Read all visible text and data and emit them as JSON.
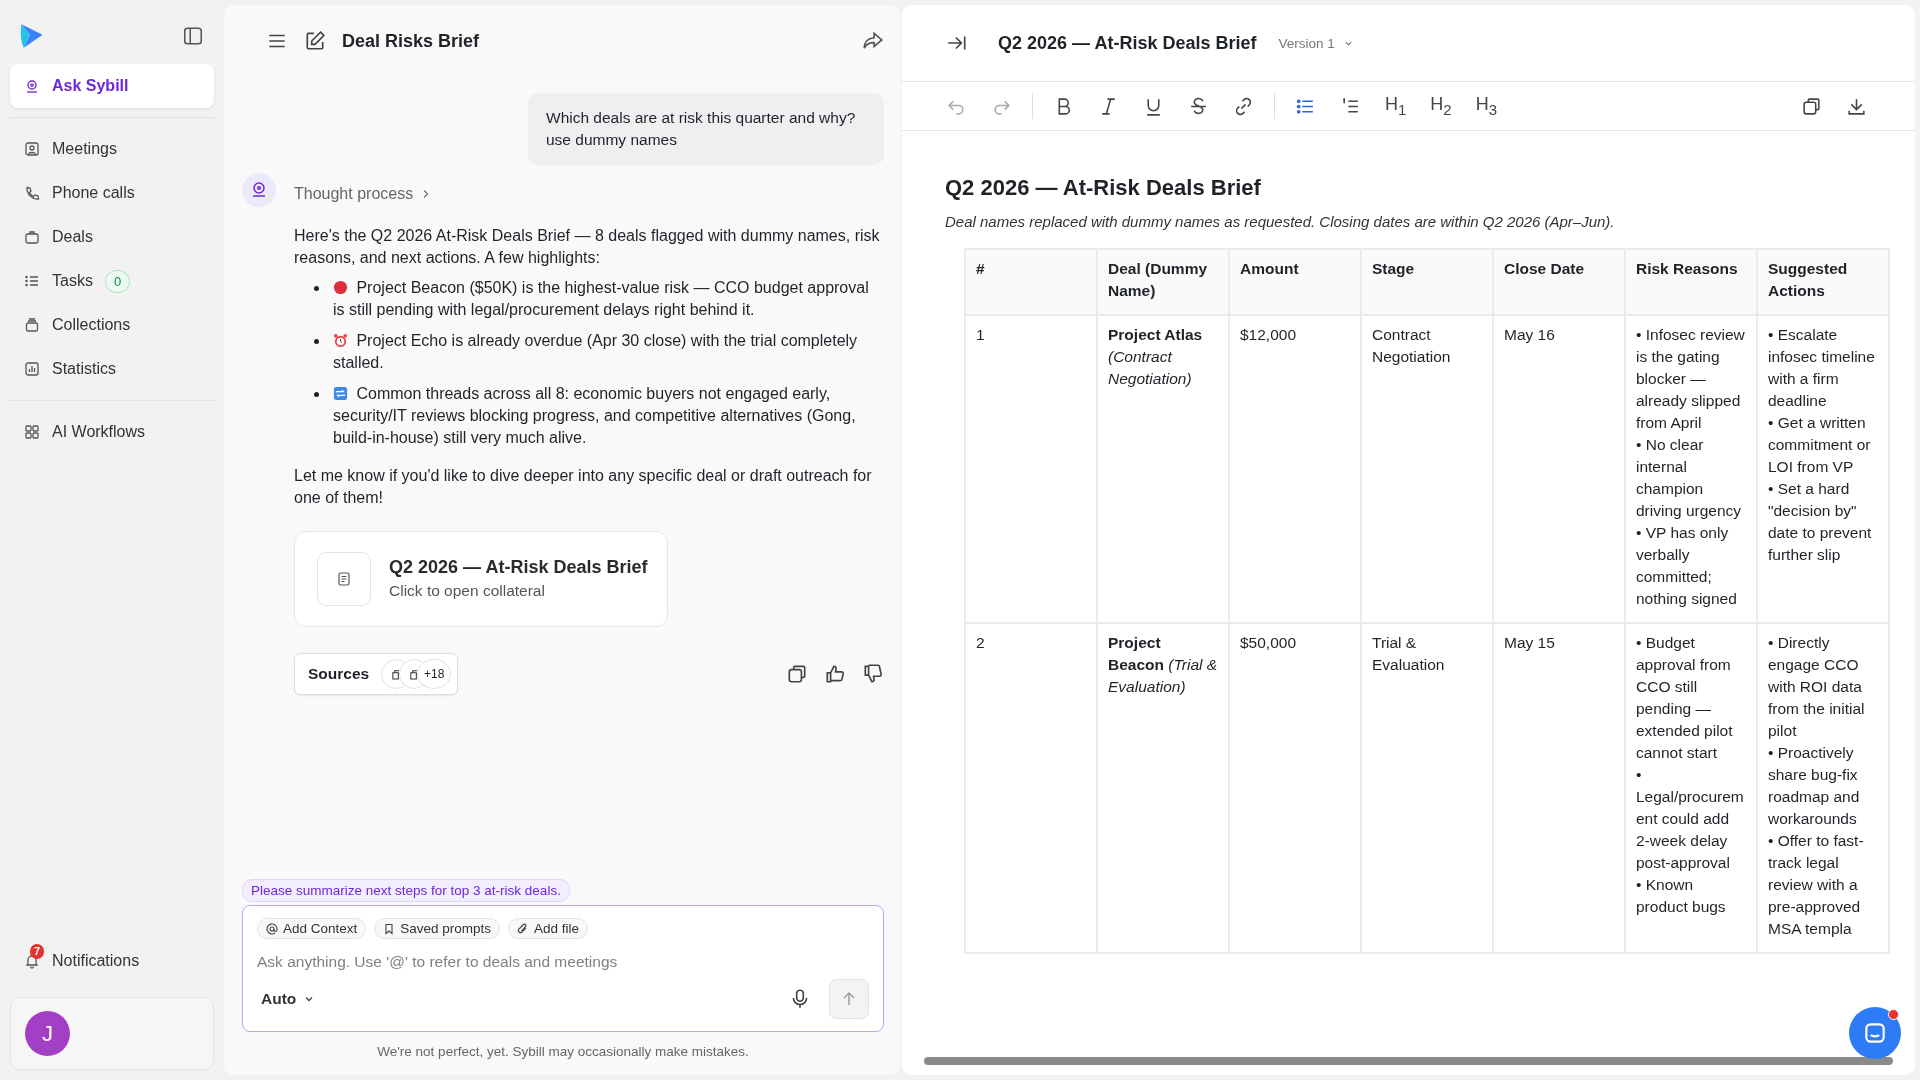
{
  "sidebar": {
    "nav": [
      {
        "label": "Ask Sybill",
        "selected": true
      },
      {
        "label": "Meetings",
        "selected": false
      },
      {
        "label": "Phone calls",
        "selected": false
      },
      {
        "label": "Deals",
        "selected": false
      },
      {
        "label": "Tasks",
        "selected": false,
        "badge": "0"
      },
      {
        "label": "Collections",
        "selected": false
      },
      {
        "label": "Statistics",
        "selected": false
      }
    ],
    "workflows": {
      "label": "AI Workflows",
      "selected": false
    },
    "notifications": {
      "label": "Notifications",
      "badge": "7"
    },
    "avatar": {
      "initial": "J"
    }
  },
  "chat": {
    "title": "Deal Risks Brief",
    "user_message": "Which deals are at risk this quarter and why? use dummy names",
    "thought_label": "Thought process",
    "intro": "Here's the Q2 2026 At-Risk Deals Brief — 8 deals flagged with dummy names, risk reasons, and next actions. A few highlights:",
    "highlights": [
      "Project Beacon ($50K) is the highest-value risk — CCO budget approval is still pending with legal/procurement delays right behind it.",
      "Project Echo is already overdue (Apr 30 close) with the trial completely stalled.",
      "Common threads across all 8: economic buyers not engaged early, security/IT reviews blocking progress, and competitive alternatives (Gong, build-in-house) still very much alive."
    ],
    "closing": "Let me know if you'd like to dive deeper into any specific deal or draft outreach for one of them!",
    "collateral": {
      "title": "Q2 2026 — At-Risk Deals Brief",
      "subtitle": "Click to open collateral"
    },
    "sources": {
      "label": "Sources",
      "count": "+18"
    },
    "suggestion": "Please summarize next steps for top 3 at-risk deals.",
    "composer": {
      "chips": [
        "Add Context",
        "Saved prompts",
        "Add file"
      ],
      "placeholder": "Ask anything. Use '@' to refer to deals and meetings",
      "mode": "Auto"
    },
    "disclaimer": "We're not perfect, yet. Sybill may occasionally make mistakes."
  },
  "document": {
    "title": "Q2 2026 — At-Risk Deals Brief",
    "version": "Version 1",
    "toolbar": [
      {
        "kind": "undo",
        "disabled": true
      },
      {
        "kind": "redo",
        "disabled": true
      },
      {
        "kind": "divider"
      },
      {
        "kind": "bold",
        "active": false
      },
      {
        "kind": "italic",
        "active": false
      },
      {
        "kind": "underline",
        "active": false
      },
      {
        "kind": "strike",
        "active": false
      },
      {
        "kind": "link",
        "active": false
      },
      {
        "kind": "divider"
      },
      {
        "kind": "bullets",
        "active": true
      },
      {
        "kind": "numbers",
        "active": false
      },
      {
        "kind": "heading",
        "label": "H$_{1}$",
        "active": false
      },
      {
        "kind": "heading",
        "label": "H$_{2}$",
        "active": false
      },
      {
        "kind": "heading",
        "label": "H$_{3}$",
        "active": false
      }
    ],
    "heading": "Q2 2026 — At-Risk Deals Brief",
    "note": "Deal names replaced with dummy names as requested. Closing dates are within Q2 2026 (Apr–Jun).",
    "table": {
      "columns": [
        "#",
        "Deal (Dummy Name)",
        "Amount",
        "Stage",
        "Close Date",
        "Risk Reasons",
        "Suggested Actions"
      ],
      "rows": [
        {
          "number": "1",
          "deal": "**Project Atlas** *(Contract Negotiation)*",
          "amount": "$12,000",
          "stage": "Contract Negotiation",
          "close_date": "May 16",
          "risk_reasons": [
            "• Infosec review is the gating blocker — already slipped from April",
            "• No clear internal champion driving urgency",
            "• VP has only verbally committed; nothing signed"
          ],
          "suggested_actions": [
            "• Escalate infosec timeline with a firm deadline",
            "• Get a written commitment or LOI from VP",
            "• Set a hard \"decision by\" date to prevent further slip"
          ]
        },
        {
          "number": "2",
          "deal": "**Project Beacon** *(Trial & Evaluation)*",
          "amount": "$50,000",
          "stage": "Trial & Evaluation",
          "close_date": "May 15",
          "risk_reasons": [
            "• Budget approval from CCO still pending — extended pilot cannot start",
            "• Legal/procurement could add 2-week delay post-approval",
            "• Known product bugs"
          ],
          "suggested_actions": [
            "• Directly engage CCO with ROI data from the initial pilot",
            "• Proactively share bug-fix roadmap and workarounds",
            "• Offer to fast-track legal review with a pre-approved MSA templa"
          ]
        }
      ]
    }
  }
}
